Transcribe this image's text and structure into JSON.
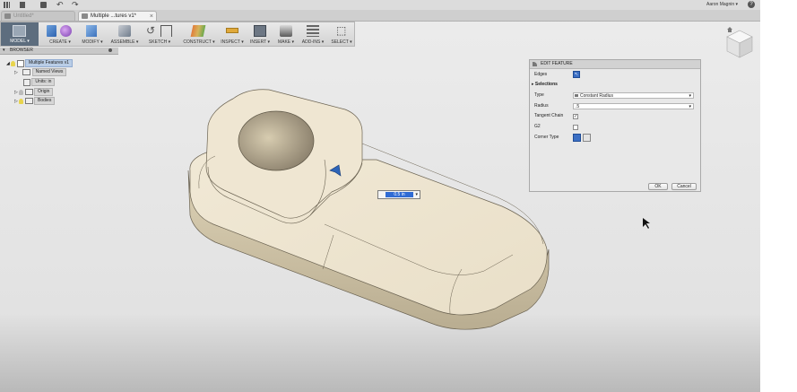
{
  "colors": {
    "accent": "#2f6bd4",
    "model_bg": "#5d6d7e",
    "part": "#efe6d2"
  },
  "tabs": [
    {
      "label": "Untitled*"
    },
    {
      "label": "Multiple ...tures v1*"
    }
  ],
  "user": {
    "name": "Aaron Magnin ▾",
    "help": "?"
  },
  "toolbar": {
    "model": "MODEL ▾",
    "create": "CREATE ▾",
    "modify": "MODIFY ▾",
    "assemble": "ASSEMBLE ▾",
    "sketch": "SKETCH ▾",
    "construct": "CONSTRUCT ▾",
    "inspect": "INSPECT ▾",
    "insert": "INSERT ▾",
    "make": "MAKE ▾",
    "addins": "ADD-INS ▾",
    "select": "SELECT ▾"
  },
  "browser": {
    "title": "BROWSER",
    "root": "Multiple Features v1",
    "items": [
      {
        "label": "Named Views"
      },
      {
        "label": "Units: in"
      },
      {
        "label": "Origin"
      },
      {
        "label": "Bodies"
      }
    ]
  },
  "edit_feature": {
    "title": "EDIT FEATURE",
    "edges_label": "Edges",
    "selections_label": "Selections",
    "type_label": "Type",
    "type_value": "Constant Radius",
    "radius_label": "Radius",
    "radius_value": ".5",
    "tangent_label": "Tangent Chain",
    "g2_label": "G2",
    "corner_label": "Corner Type",
    "ok": "OK",
    "cancel": "Cancel"
  },
  "dimension": {
    "value": "0.5 in"
  }
}
